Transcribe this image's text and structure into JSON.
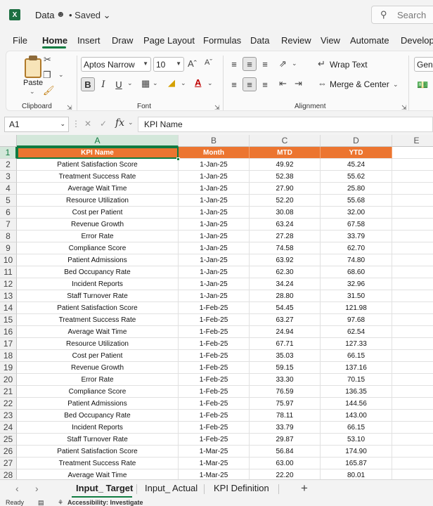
{
  "titlebar": {
    "doc_name": "Data",
    "saved_label": "• Saved",
    "search_placeholder": "Search"
  },
  "tabs": [
    "File",
    "Home",
    "Insert",
    "Draw",
    "Page Layout",
    "Formulas",
    "Data",
    "Review",
    "View",
    "Automate",
    "Develope"
  ],
  "active_tab": "Home",
  "ribbon": {
    "paste_label": "Paste",
    "clipboard_label": "Clipboard",
    "font_name": "Aptos Narrow",
    "font_size": "10",
    "font_label": "Font",
    "bold": "B",
    "italic": "I",
    "underline": "U",
    "wrap_text": "Wrap Text",
    "merge_center": "Merge & Center",
    "alignment_label": "Alignment",
    "number_format": "Gene"
  },
  "formula_bar": {
    "name_box": "A1",
    "fx_label": "fx",
    "formula": "KPI Name"
  },
  "columns": [
    "A",
    "B",
    "C",
    "D",
    "E"
  ],
  "header_row": [
    "KPI Name",
    "Month",
    "MTD",
    "YTD"
  ],
  "rows": [
    [
      "Patient Satisfaction Score",
      "1-Jan-25",
      "49.92",
      "45.24"
    ],
    [
      "Treatment Success Rate",
      "1-Jan-25",
      "52.38",
      "55.62"
    ],
    [
      "Average Wait Time",
      "1-Jan-25",
      "27.90",
      "25.80"
    ],
    [
      "Resource Utilization",
      "1-Jan-25",
      "52.20",
      "55.68"
    ],
    [
      "Cost per Patient",
      "1-Jan-25",
      "30.08",
      "32.00"
    ],
    [
      "Revenue Growth",
      "1-Jan-25",
      "63.24",
      "67.58"
    ],
    [
      "Error Rate",
      "1-Jan-25",
      "27.28",
      "33.79"
    ],
    [
      "Compliance Score",
      "1-Jan-25",
      "74.58",
      "62.70"
    ],
    [
      "Patient Admissions",
      "1-Jan-25",
      "63.92",
      "74.80"
    ],
    [
      "Bed Occupancy Rate",
      "1-Jan-25",
      "62.30",
      "68.60"
    ],
    [
      "Incident Reports",
      "1-Jan-25",
      "34.24",
      "32.96"
    ],
    [
      "Staff Turnover Rate",
      "1-Jan-25",
      "28.80",
      "31.50"
    ],
    [
      "Patient Satisfaction Score",
      "1-Feb-25",
      "54.45",
      "121.98"
    ],
    [
      "Treatment Success Rate",
      "1-Feb-25",
      "63.27",
      "97.68"
    ],
    [
      "Average Wait Time",
      "1-Feb-25",
      "24.94",
      "62.54"
    ],
    [
      "Resource Utilization",
      "1-Feb-25",
      "67.71",
      "127.33"
    ],
    [
      "Cost per Patient",
      "1-Feb-25",
      "35.03",
      "66.15"
    ],
    [
      "Revenue Growth",
      "1-Feb-25",
      "59.15",
      "137.16"
    ],
    [
      "Error Rate",
      "1-Feb-25",
      "33.30",
      "70.15"
    ],
    [
      "Compliance Score",
      "1-Feb-25",
      "76.59",
      "136.35"
    ],
    [
      "Patient Admissions",
      "1-Feb-25",
      "75.97",
      "144.56"
    ],
    [
      "Bed Occupancy Rate",
      "1-Feb-25",
      "78.11",
      "143.00"
    ],
    [
      "Incident Reports",
      "1-Feb-25",
      "33.79",
      "66.15"
    ],
    [
      "Staff Turnover Rate",
      "1-Feb-25",
      "29.87",
      "53.10"
    ],
    [
      "Patient Satisfaction Score",
      "1-Mar-25",
      "56.84",
      "174.90"
    ],
    [
      "Treatment Success Rate",
      "1-Mar-25",
      "63.00",
      "165.87"
    ],
    [
      "Average Wait Time",
      "1-Mar-25",
      "22.20",
      "80.01"
    ]
  ],
  "sheets": [
    "Input_ Target",
    "Input_ Actual",
    "KPI Definition"
  ],
  "active_sheet": "Input_ Target",
  "status": {
    "ready": "Ready",
    "accessibility": "Accessibility: Investigate"
  },
  "colors": {
    "header_fill": "#ec7530",
    "accent": "#107c41"
  }
}
